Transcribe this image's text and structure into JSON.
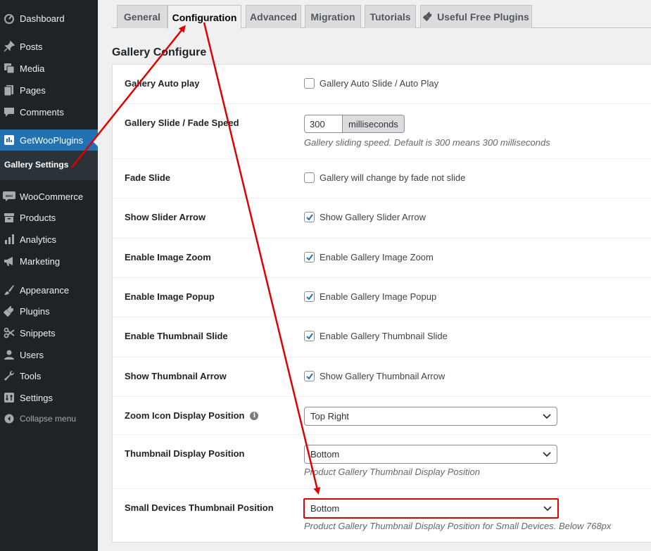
{
  "sidebar": {
    "items": [
      {
        "label": "Dashboard",
        "icon": "dashboard-icon"
      },
      {
        "label": "Posts",
        "icon": "pin-icon"
      },
      {
        "label": "Media",
        "icon": "media-icon"
      },
      {
        "label": "Pages",
        "icon": "pages-icon"
      },
      {
        "label": "Comments",
        "icon": "comment-icon"
      },
      {
        "label": "GetWooPlugins",
        "icon": "getwoo-icon"
      },
      {
        "label": "WooCommerce",
        "icon": "woo-icon"
      },
      {
        "label": "Products",
        "icon": "archive-icon"
      },
      {
        "label": "Analytics",
        "icon": "bar-chart-icon"
      },
      {
        "label": "Marketing",
        "icon": "megaphone-icon"
      },
      {
        "label": "Appearance",
        "icon": "brush-icon"
      },
      {
        "label": "Plugins",
        "icon": "plug-icon"
      },
      {
        "label": "Snippets",
        "icon": "scissors-icon"
      },
      {
        "label": "Users",
        "icon": "user-icon"
      },
      {
        "label": "Tools",
        "icon": "wrench-icon"
      },
      {
        "label": "Settings",
        "icon": "settings-icon"
      },
      {
        "label": "Collapse menu",
        "icon": "collapse-icon"
      }
    ],
    "submenu_label": "Gallery Settings",
    "accent": "#2271b1"
  },
  "tabs": [
    {
      "label": "General"
    },
    {
      "label": "Configuration"
    },
    {
      "label": "Advanced"
    },
    {
      "label": "Migration"
    },
    {
      "label": "Tutorials"
    },
    {
      "label": "Useful Free Plugins"
    }
  ],
  "section_title": "Gallery Configure",
  "fields": {
    "autoplay": {
      "label": "Gallery Auto play",
      "option": "Gallery Auto Slide / Auto Play",
      "checked": false
    },
    "speed": {
      "label": "Gallery Slide / Fade Speed",
      "value": "300",
      "unit": "milliseconds",
      "description": "Gallery sliding speed. Default is 300 means 300 milliseconds"
    },
    "fade": {
      "label": "Fade Slide",
      "option": "Gallery will change by fade not slide",
      "checked": false
    },
    "arrow": {
      "label": "Show Slider Arrow",
      "option": "Show Gallery Slider Arrow",
      "checked": true
    },
    "zoom": {
      "label": "Enable Image Zoom",
      "option": "Enable Gallery Image Zoom",
      "checked": true
    },
    "popup": {
      "label": "Enable Image Popup",
      "option": "Enable Gallery Image Popup",
      "checked": true
    },
    "thumb_slide": {
      "label": "Enable Thumbnail Slide",
      "option": "Enable Gallery Thumbnail Slide",
      "checked": true
    },
    "thumb_arrow": {
      "label": "Show Thumbnail Arrow",
      "option": "Show Gallery Thumbnail Arrow",
      "checked": true
    },
    "zoom_pos": {
      "label": "Zoom Icon Display Position",
      "value": "Top Right"
    },
    "thumb_pos": {
      "label": "Thumbnail Display Position",
      "value": "Bottom",
      "description": "Product Gallery Thumbnail Display Position"
    },
    "small_pos": {
      "label": "Small Devices Thumbnail Position",
      "value": "Bottom",
      "description": "Product Gallery Thumbnail Display Position for Small Devices. Below 768px"
    }
  },
  "annotation_color": "#e00000"
}
